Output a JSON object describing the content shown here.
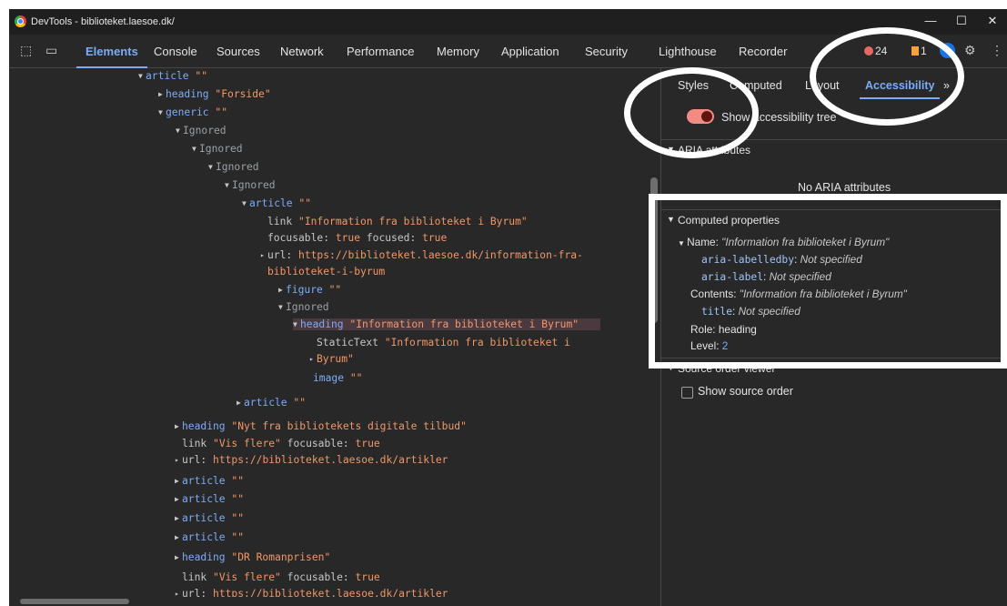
{
  "window": {
    "title": "DevTools - biblioteket.laesoe.dk/",
    "controls": [
      "—",
      "☐",
      "✕"
    ]
  },
  "tabs": [
    "Elements",
    "Console",
    "Sources",
    "Network",
    "Performance",
    "Memory",
    "Application",
    "Security",
    "Lighthouse",
    "Recorder"
  ],
  "badges": {
    "errors": "24",
    "warnings": "1",
    "more": "»"
  },
  "side_tabs": [
    "Styles",
    "Computed",
    "Layout",
    "Accessibility",
    "»"
  ],
  "toggle_label": "Show accessibility tree",
  "aria": {
    "title": "ARIA attributes",
    "empty": "No ARIA attributes"
  },
  "computed": {
    "title": "Computed properties",
    "name_label": "Name:",
    "name_value": "\"Information fra biblioteket i Byrum\"",
    "labelledby_key": "aria-labelledby",
    "labelledby_val": "Not specified",
    "label_key": "aria-label",
    "label_val": "Not specified",
    "contents_key": "Contents:",
    "contents_val": "\"Information fra biblioteket i Byrum\"",
    "title_key": "title",
    "title_val": "Not specified",
    "role_key": "Role:",
    "role_val": "heading",
    "level_key": "Level:",
    "level_val": "2"
  },
  "source_order": {
    "title": "Source order viewer",
    "checkbox": "Show source order"
  },
  "tree": [
    {
      "arrow": "▼",
      "role": "article",
      "val": "\"\""
    },
    {
      "arrow": "▶",
      "role": "heading",
      "val": "\"Forside\""
    },
    {
      "arrow": "▼",
      "role": "generic",
      "val": "\"\""
    },
    {
      "arrow": "▼",
      "ign": "Ignored"
    },
    {
      "arrow": "▼",
      "ign": "Ignored"
    },
    {
      "arrow": "▼",
      "ign": "Ignored"
    },
    {
      "arrow": "▼",
      "ign": "Ignored"
    },
    {
      "arrow": "▼",
      "role": "article",
      "val": "\"\""
    },
    {
      "arrow": "",
      "plain": "link",
      "val": "\"Information fra biblioteket i Byrum\""
    },
    {
      "arrow": "",
      "plain": "focusable:",
      "val": "true",
      "plain2": " focused:",
      "val2": "true"
    },
    {
      "arrow": "▸",
      "plain": "url:",
      "val": "https://biblioteket.laesoe.dk/information-fra-"
    },
    {
      "arrow": "",
      "val": "biblioteket-i-byrum"
    },
    {
      "arrow": "▶",
      "role": "figure",
      "val": "\"\""
    },
    {
      "arrow": "▼",
      "ign": "Ignored"
    },
    {
      "arrow": "▼",
      "role": "heading",
      "val": "\"Information fra biblioteket i Byrum\""
    },
    {
      "arrow": "",
      "plain": "StaticText",
      "val": "\"Information fra biblioteket i"
    },
    {
      "arrow": "▸",
      "val": "Byrum\""
    },
    {
      "arrow": "",
      "role": "image",
      "val": "\"\""
    },
    {
      "arrow": "▶",
      "role": "article",
      "val": "\"\""
    },
    {
      "arrow": "▶",
      "role": "heading",
      "val": "\"Nyt fra bibliotekets digitale tilbud\""
    },
    {
      "arrow": "",
      "plain": "link",
      "val": "\"Vis flere\"",
      "plain2": " focusable:",
      "val2": "true"
    },
    {
      "arrow": "▸",
      "plain": "url:",
      "val": "https://biblioteket.laesoe.dk/artikler"
    },
    {
      "arrow": "▶",
      "role": "article",
      "val": "\"\""
    },
    {
      "arrow": "▶",
      "role": "article",
      "val": "\"\""
    },
    {
      "arrow": "▶",
      "role": "article",
      "val": "\"\""
    },
    {
      "arrow": "▶",
      "role": "article",
      "val": "\"\""
    },
    {
      "arrow": "▶",
      "role": "heading",
      "val": "\"DR Romanprisen\""
    },
    {
      "arrow": "",
      "plain": "link",
      "val": "\"Vis flere\"",
      "plain2": " focusable:",
      "val2": "true"
    },
    {
      "arrow": "▸",
      "plain": "url:",
      "val": "https://biblioteket.laesoe.dk/artikler"
    }
  ]
}
